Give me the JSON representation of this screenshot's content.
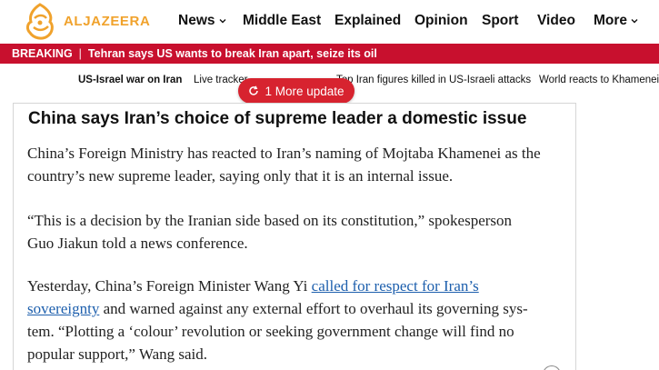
{
  "header": {
    "logo_text": "ALJAZEERA",
    "nav": [
      {
        "label": "News",
        "has_dropdown": true
      },
      {
        "label": "Middle East",
        "has_dropdown": false
      },
      {
        "label": "Explained",
        "has_dropdown": false
      },
      {
        "label": "Opinion",
        "has_dropdown": false
      },
      {
        "label": "Sport",
        "has_dropdown": false
      },
      {
        "label": "Video",
        "has_dropdown": false
      },
      {
        "label": "More",
        "has_dropdown": true
      }
    ]
  },
  "breaking": {
    "label": "BREAKING",
    "text": "Tehran says US wants to break Iran apart, seize its oil"
  },
  "topics": [
    "US-Israel war on Iran",
    "Live tracker",
    "Top Iran figures killed in US-Israeli attacks",
    "World reacts to Khamenei's"
  ],
  "update_pill": {
    "label": "1 More update"
  },
  "article": {
    "headline": "China says Iran’s choice of supreme leader a domestic issue",
    "p1_lines": [
      "China’s Foreign Ministry has reacted to Iran’s naming of Mojtaba Khamenei as the",
      "country’s new supreme leader, saying only that it is an internal issue."
    ],
    "p2_lines": [
      "“This is a decision by the Iranian side based on its constitution,” spokesperson",
      "Guo Jiakun told a news conference."
    ],
    "p3": {
      "before_link": "Yesterday, China’s Foreign Minister Wang Yi ",
      "link_line1": "called for respect for Iran’s",
      "link_line2": "sovereignty",
      "after_link": " and warned against any external effort to overhaul its governing sys-",
      "line3": "tem. “Plotting a ‘colour’ revolution or seeking government change will find no",
      "line4": "popular support,” Wang said."
    }
  },
  "colors": {
    "brand": "#f0a22c",
    "breaking_bg": "#c8102e",
    "pill_bg": "#d7232f",
    "link": "#1d5fad"
  }
}
